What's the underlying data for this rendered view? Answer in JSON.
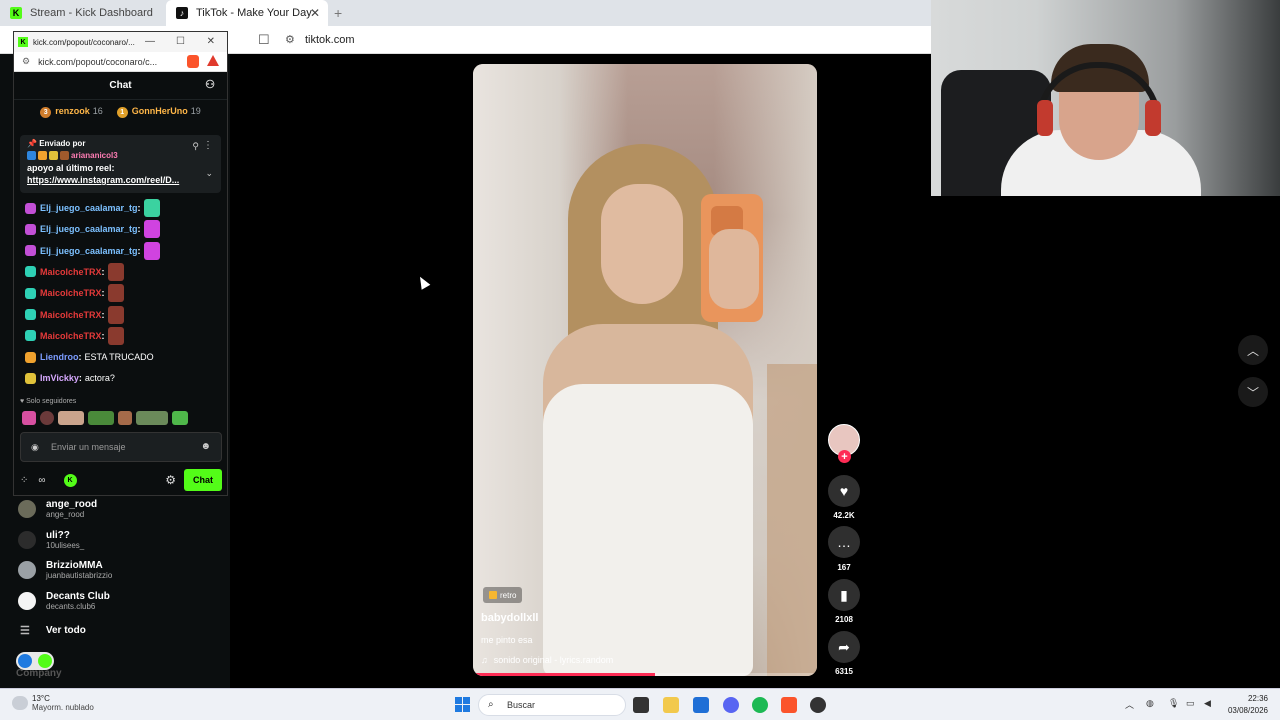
{
  "browser": {
    "tabs": [
      {
        "label": "Stream - Kick Dashboard",
        "active": false
      },
      {
        "label": "TikTok - Make Your Day",
        "active": true
      }
    ],
    "address": "tiktok.com"
  },
  "kick_popup": {
    "title": "kick.com/popout/coconaro/...",
    "url": "kick.com/popout/coconaro/c...",
    "chat_title": "Chat",
    "leaders": [
      {
        "rank": "3",
        "name": "renzook",
        "count": "16"
      },
      {
        "rank": "1",
        "name": "GonnHerUno",
        "count": "19"
      }
    ],
    "pinned": {
      "label": "Enviado por",
      "user": "ariananicol3",
      "message": "apoyo al último reel:",
      "link": "https://www.instagram.com/reel/D..."
    },
    "messages": [
      {
        "user": "Elj_juego_caalamar_tg",
        "text": "",
        "color": "#7cc0ff",
        "badge_color": "#c24fd6",
        "emote_color": "#3bd2a0"
      },
      {
        "user": "Elj_juego_caalamar_tg",
        "text": "",
        "color": "#7cc0ff",
        "badge_color": "#c24fd6",
        "emote_color": "#d043e0"
      },
      {
        "user": "Elj_juego_caalamar_tg",
        "text": "",
        "color": "#7cc0ff",
        "badge_color": "#c24fd6",
        "emote_color": "#d043e0"
      },
      {
        "user": "MaicolcheTRX",
        "text": "",
        "color": "#e53a3a",
        "badge_color": "#2ed1b5",
        "emote_color": "#8a3a2e"
      },
      {
        "user": "MaicolcheTRX",
        "text": "",
        "color": "#e53a3a",
        "badge_color": "#2ed1b5",
        "emote_color": "#8a3a2e"
      },
      {
        "user": "MaicolcheTRX",
        "text": "",
        "color": "#e53a3a",
        "badge_color": "#2ed1b5",
        "emote_color": "#8a3a2e"
      },
      {
        "user": "MaicolcheTRX",
        "text": "",
        "color": "#e53a3a",
        "badge_color": "#2ed1b5",
        "emote_color": "#8a3a2e"
      },
      {
        "user": "Liendroo",
        "text": "ESTA TRUCADO",
        "color": "#7c9cff",
        "badge_color": "#f0a22e",
        "emote_color": ""
      },
      {
        "user": "ImVickky",
        "text": "actora?",
        "color": "#d7a9ff",
        "badge_color": "#e0c23a",
        "emote_color": ""
      }
    ],
    "followers_only_label": "Solo seguidores",
    "input_placeholder": "Enviar un mensaje",
    "chat_button": "Chat"
  },
  "kick_sidebar": {
    "following": [
      {
        "name": "ange_rood",
        "sub": "ange_rood"
      },
      {
        "name": "uli??",
        "sub": "10ulisees_"
      },
      {
        "name": "BrizzioMMA",
        "sub": "juanbautistabrizzio"
      },
      {
        "name": "Decants Club",
        "sub": "decants.club6"
      }
    ],
    "see_all": "Ver todo",
    "company": "Company"
  },
  "tiktok": {
    "tag": "retro",
    "username": "babydollxll",
    "description": "me pinto esa",
    "sound": "sonido original - lyrics.random",
    "progress": 0.53,
    "likes": "42.2K",
    "comments": "167",
    "saves": "2108",
    "shares": "6315"
  },
  "taskbar": {
    "weather_temp": "13°C",
    "weather_desc": "Mayorm. nublado",
    "search_placeholder": "Buscar",
    "time": "22:36",
    "date": "03/08/2026"
  }
}
